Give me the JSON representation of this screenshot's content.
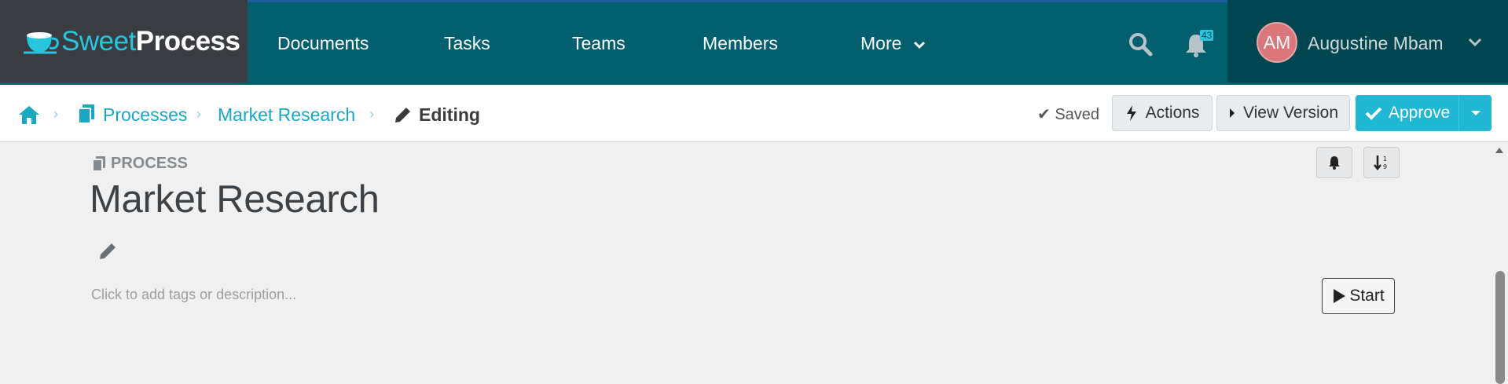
{
  "header": {
    "logo": {
      "sweet": "Sweet",
      "process": "Process"
    },
    "nav": [
      "Documents",
      "Tasks",
      "Teams",
      "Members",
      "More"
    ],
    "notification_count": "43",
    "user": {
      "initials": "AM",
      "name": "Augustine Mbam"
    }
  },
  "breadcrumb": {
    "items": [
      "Processes",
      "Market Research"
    ],
    "current": "Editing"
  },
  "toolbar": {
    "saved_label": "Saved",
    "actions_label": "Actions",
    "view_version_label": "View Version",
    "approve_label": "Approve"
  },
  "process": {
    "type_label": "PROCESS",
    "title": "Market Research",
    "tags_placeholder": "Click to add tags or description...",
    "start_label": "Start"
  },
  "colors": {
    "nav_bg": "#02606e",
    "logo_bg": "#393c41",
    "accent": "#20b7d5",
    "link": "#17a8c4"
  }
}
